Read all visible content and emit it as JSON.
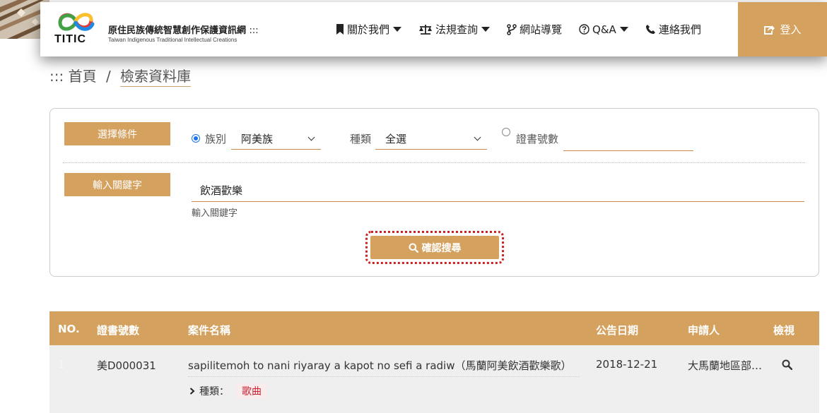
{
  "header": {
    "logo_text": "TITIC",
    "site_title_zh": "原住民族傳統智慧創作保護資訊網",
    "site_title_suffix": ":::",
    "site_title_en": "Taiwan Indigenous Traditional Intellectual Creations",
    "nav": [
      {
        "label": "關於我們",
        "icon": "bookmark-icon",
        "has_caret": true
      },
      {
        "label": "法規查詢",
        "icon": "scale-icon",
        "has_caret": true
      },
      {
        "label": "網站導覽",
        "icon": "branch-icon",
        "has_caret": false
      },
      {
        "label": "Q&A",
        "icon": "question-circle-icon",
        "has_caret": true
      },
      {
        "label": "連絡我們",
        "icon": "phone-icon",
        "has_caret": false
      }
    ],
    "login_label": "登入"
  },
  "breadcrumb": {
    "prefix": ":::",
    "home": "首頁",
    "separator": "/",
    "current": "檢索資料庫"
  },
  "search": {
    "condition_label": "選擇條件",
    "radio_tribe_label": "族別",
    "tribe_value": "阿美族",
    "type_label": "種類",
    "type_value": "全選",
    "radio_cert_label": "證書號數",
    "cert_value": "",
    "keyword_label": "輸入關鍵字",
    "keyword_value": "飲酒歡樂",
    "keyword_helper": "輸入關鍵字",
    "submit_label": "確認搜尋"
  },
  "table": {
    "headers": {
      "no": "NO.",
      "cert": "證書號數",
      "name": "案件名稱",
      "date": "公告日期",
      "applicant": "申請人",
      "view": "檢視"
    },
    "rows": [
      {
        "no": "1",
        "cert": "美D000031",
        "name": "sapilitemoh to nani riyaray a kapot no sefi a radiw（馬蘭阿美飲酒歡樂歌）",
        "date": "2018-12-21",
        "applicant": "大馬蘭地區部…",
        "type_label": "種類：",
        "type_value": "歌曲"
      }
    ]
  },
  "colors": {
    "accent": "#d4a15e",
    "underline": "#c9894a",
    "focus_ring": "#cc2222",
    "radio": "#1a73e8"
  }
}
